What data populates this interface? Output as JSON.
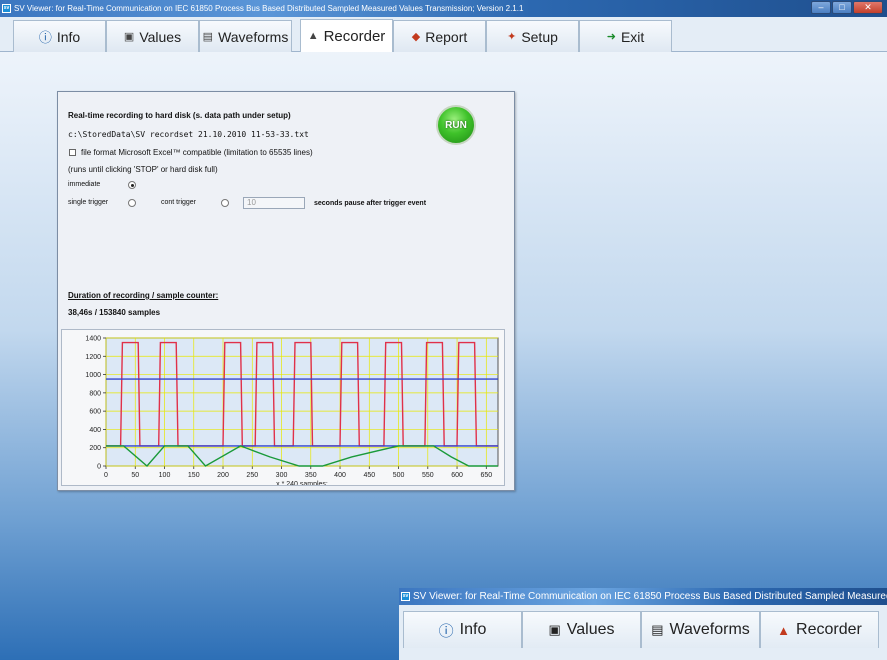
{
  "window": {
    "title": "SV Viewer: for Real-Time Communication on IEC 61850 Process Bus Based Distributed Sampled Measured Values Transmission; Version 2.1.1",
    "icon_label": "sv"
  },
  "tabs": [
    {
      "label": "Info",
      "icon": "info-icon"
    },
    {
      "label": "Values",
      "icon": "values-icon"
    },
    {
      "label": "Waveforms",
      "icon": "waveforms-icon"
    },
    {
      "label": "Recorder",
      "icon": "recorder-icon",
      "active": true
    },
    {
      "label": "Report",
      "icon": "report-icon"
    },
    {
      "label": "Setup",
      "icon": "setup-icon"
    },
    {
      "label": "Exit",
      "icon": "exit-icon"
    }
  ],
  "recorder": {
    "heading": "Real-time recording to hard disk (s. data path under setup)",
    "file_path": "c:\\StoredData\\SV recordset 21.10.2010 11-53-33.txt",
    "excel_option": "file format Microsoft Excel™ compatible (limitation to 65535 lines)",
    "note": "(runs until clicking 'STOP' or hard disk full)",
    "immediate_label": "immediate",
    "single_trigger_label": "single trigger",
    "cont_trigger_label": "cont trigger",
    "pause_value": "10",
    "pause_suffix": "seconds pause after trigger event",
    "run_label": "RUN",
    "duration_heading": "Duration of recording / sample counter:",
    "duration_value": "38,46s / 153840 samples"
  },
  "chart_data": {
    "type": "line",
    "xlabel": "x * 240 samples:",
    "xlim": [
      0,
      670
    ],
    "ylim": [
      0,
      1400
    ],
    "x_ticks": [
      0,
      50,
      100,
      150,
      200,
      250,
      300,
      350,
      400,
      450,
      500,
      550,
      600,
      650
    ],
    "y_ticks": [
      0,
      200,
      400,
      600,
      800,
      1000,
      1200,
      1400
    ],
    "grid": true,
    "colors": {
      "background": "#dce8f6",
      "grid": "#e8e800",
      "red": "#e0304a",
      "blue": "#3344cc",
      "green": "#1a9a3a"
    },
    "series": [
      {
        "color": "red",
        "points": [
          [
            0,
            220
          ],
          [
            25,
            220
          ],
          [
            28,
            1350
          ],
          [
            55,
            1350
          ],
          [
            58,
            220
          ],
          [
            90,
            220
          ],
          [
            93,
            1350
          ],
          [
            120,
            1350
          ],
          [
            123,
            220
          ],
          [
            200,
            220
          ],
          [
            203,
            1350
          ],
          [
            230,
            1350
          ],
          [
            233,
            220
          ],
          [
            255,
            220
          ],
          [
            258,
            1350
          ],
          [
            285,
            1350
          ],
          [
            288,
            220
          ],
          [
            320,
            220
          ],
          [
            323,
            1350
          ],
          [
            350,
            1350
          ],
          [
            353,
            220
          ],
          [
            400,
            220
          ],
          [
            403,
            1350
          ],
          [
            430,
            1350
          ],
          [
            433,
            220
          ],
          [
            475,
            220
          ],
          [
            478,
            1350
          ],
          [
            505,
            1350
          ],
          [
            508,
            220
          ],
          [
            545,
            220
          ],
          [
            548,
            1350
          ],
          [
            575,
            1350
          ],
          [
            578,
            220
          ],
          [
            600,
            220
          ],
          [
            603,
            1350
          ],
          [
            630,
            1350
          ],
          [
            633,
            220
          ],
          [
            670,
            220
          ]
        ]
      },
      {
        "color": "blue",
        "points": [
          [
            0,
            950
          ],
          [
            670,
            950
          ]
        ]
      },
      {
        "color": "blue",
        "points": [
          [
            0,
            220
          ],
          [
            670,
            220
          ]
        ]
      },
      {
        "color": "green",
        "points": [
          [
            0,
            220
          ],
          [
            30,
            220
          ],
          [
            70,
            0
          ],
          [
            100,
            220
          ],
          [
            140,
            220
          ],
          [
            170,
            0
          ],
          [
            230,
            220
          ],
          [
            280,
            100
          ],
          [
            330,
            0
          ],
          [
            370,
            0
          ],
          [
            420,
            100
          ],
          [
            500,
            220
          ],
          [
            560,
            220
          ],
          [
            590,
            100
          ],
          [
            620,
            0
          ],
          [
            670,
            0
          ]
        ]
      }
    ]
  },
  "second_window": {
    "title": "SV Viewer: for Real-Time Communication on IEC 61850 Process Bus Based Distributed Sampled Measured",
    "tabs": [
      {
        "label": "Info"
      },
      {
        "label": "Values"
      },
      {
        "label": "Waveforms"
      },
      {
        "label": "Recorder"
      }
    ]
  }
}
